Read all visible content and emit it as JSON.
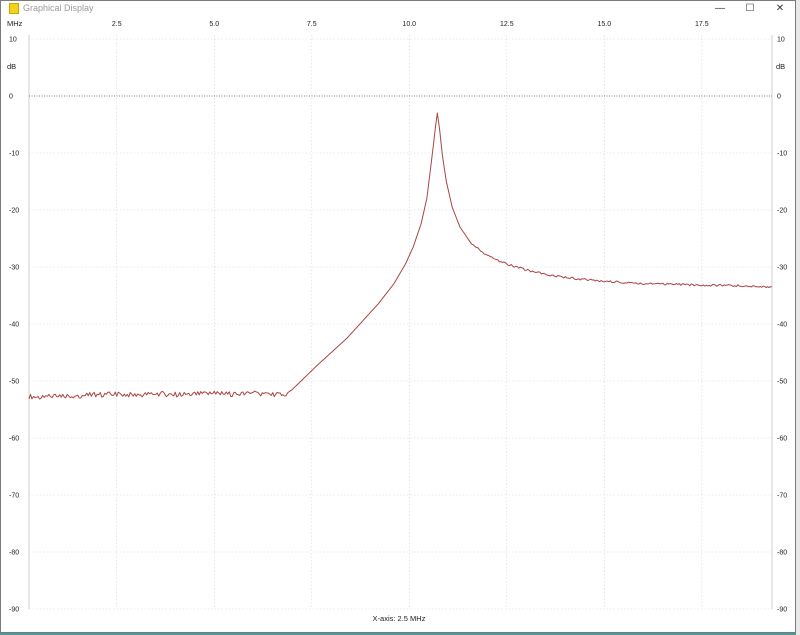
{
  "window": {
    "title": "Graphical Display",
    "minimize_symbol": "—",
    "maximize_symbol": "☐",
    "close_symbol": "✕"
  },
  "chart_data": {
    "type": "line",
    "x_unit_label": "MHz",
    "y_unit_label": "dB",
    "x_caption": "X-axis: 2.5 MHz",
    "xlim": [
      0.25,
      19.3
    ],
    "ylim": [
      -90,
      10
    ],
    "x_ticks": [
      2.5,
      5.0,
      7.5,
      10.0,
      12.5,
      15.0,
      17.5
    ],
    "x_tick_labels": [
      "2.5",
      "5.0",
      "7.5",
      "10.0",
      "12.5",
      "15.0",
      "17.5"
    ],
    "y_ticks": [
      10,
      0,
      -10,
      -20,
      -30,
      -40,
      -50,
      -60,
      -70,
      -80,
      -90
    ],
    "y_tick_labels": [
      "10",
      "0",
      "-10",
      "-20",
      "-30",
      "-40",
      "-50",
      "-60",
      "-70",
      "-80",
      "-90"
    ],
    "reference_line": 0,
    "grid": true,
    "line_color": "#a84545",
    "series": [
      {
        "x": [
          0.25,
          0.6,
          1.0,
          1.5,
          2.0,
          2.5,
          3.0,
          3.5,
          4.0,
          4.5,
          5.0,
          5.5,
          6.0,
          6.5,
          6.8,
          7.0,
          7.3,
          7.6,
          8.0,
          8.4,
          8.8,
          9.2,
          9.6,
          9.9,
          10.1,
          10.3,
          10.45,
          10.55,
          10.62,
          10.67,
          10.72,
          10.78,
          10.85,
          10.95,
          11.1,
          11.3,
          11.6,
          12.0,
          12.5,
          13.0,
          13.5,
          14.0,
          14.5,
          15.0,
          15.5,
          16.0,
          16.5,
          17.0,
          17.5,
          18.0,
          18.5,
          19.0,
          19.3
        ],
        "y": [
          -52.7,
          -52.9,
          -52.5,
          -52.6,
          -52.4,
          -52.3,
          -52.5,
          -52.2,
          -52.4,
          -52.3,
          -52.2,
          -52.3,
          -52.2,
          -52.3,
          -52.4,
          -51.5,
          -49.5,
          -47.5,
          -45.0,
          -42.5,
          -39.5,
          -36.5,
          -33.0,
          -29.5,
          -26.5,
          -22.5,
          -18.0,
          -12.5,
          -8.5,
          -5.5,
          -3.0,
          -6.0,
          -10.5,
          -15.0,
          -19.5,
          -23.0,
          -26.0,
          -28.0,
          -29.5,
          -30.5,
          -31.3,
          -31.8,
          -32.2,
          -32.5,
          -32.7,
          -32.9,
          -33.0,
          -33.1,
          -33.2,
          -33.2,
          -33.3,
          -33.4,
          -33.5
        ]
      }
    ]
  }
}
